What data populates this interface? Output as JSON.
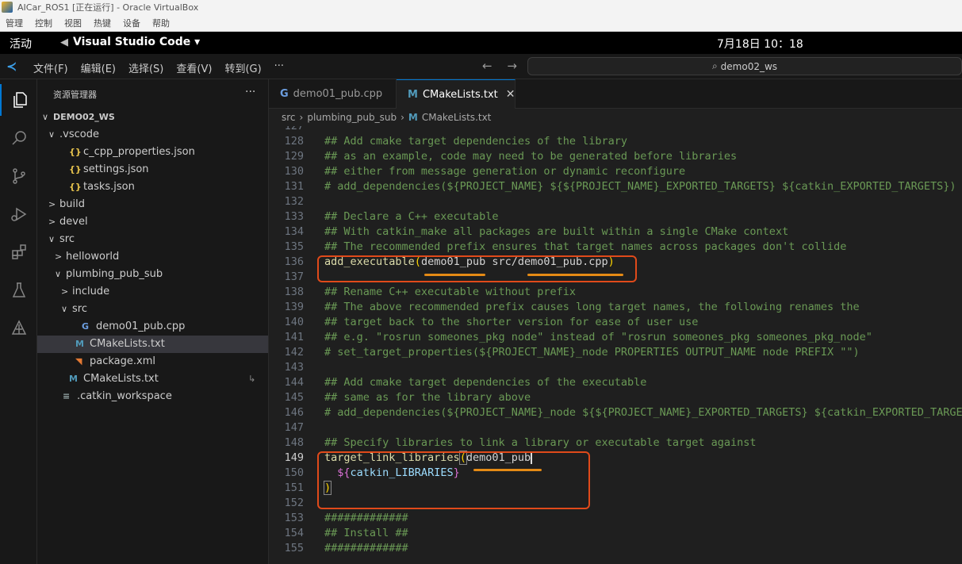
{
  "vbox": {
    "title": "AICar_ROS1 [正在运行] - Oracle VirtualBox",
    "menu": [
      "管理",
      "控制",
      "视图",
      "热键",
      "设备",
      "帮助"
    ]
  },
  "gnome": {
    "activities": "活动",
    "app_name": "Visual Studio Code ▾",
    "clock": "7月18日  10：18"
  },
  "vscode": {
    "menu": [
      "文件(F)",
      "编辑(E)",
      "选择(S)",
      "查看(V)",
      "转到(G)",
      "···"
    ],
    "nav_back": "←",
    "nav_forward": "→",
    "search_text": "demo02_ws",
    "explorer_title": "资源管理器",
    "explorer_more": "···",
    "tree": [
      {
        "label": "DEMO02_WS",
        "depth": 0,
        "chev": "∨",
        "icon": "",
        "bold": true
      },
      {
        "label": ".vscode",
        "depth": 1,
        "chev": "∨",
        "icon": ""
      },
      {
        "label": "c_cpp_properties.json",
        "depth": 2,
        "chev": "",
        "icon": "{}",
        "icon_class": "ic-json"
      },
      {
        "label": "settings.json",
        "depth": 2,
        "chev": "",
        "icon": "{}",
        "icon_class": "ic-json"
      },
      {
        "label": "tasks.json",
        "depth": 2,
        "chev": "",
        "icon": "{}",
        "icon_class": "ic-json"
      },
      {
        "label": "build",
        "depth": 1,
        "chev": ">",
        "icon": ""
      },
      {
        "label": "devel",
        "depth": 1,
        "chev": ">",
        "icon": ""
      },
      {
        "label": "src",
        "depth": 1,
        "chev": "∨",
        "icon": ""
      },
      {
        "label": "helloworld",
        "depth": 2,
        "chev": ">",
        "icon": ""
      },
      {
        "label": "plumbing_pub_sub",
        "depth": 2,
        "chev": "∨",
        "icon": ""
      },
      {
        "label": "include",
        "depth": 3,
        "chev": ">",
        "icon": ""
      },
      {
        "label": "src",
        "depth": 3,
        "chev": "∨",
        "icon": ""
      },
      {
        "label": "demo01_pub.cpp",
        "depth": 4,
        "chev": "",
        "icon": "G",
        "icon_class": "ic-cpp"
      },
      {
        "label": "CMakeLists.txt",
        "depth": 3,
        "chev": "",
        "icon": "M",
        "icon_class": "ic-m",
        "selected": true
      },
      {
        "label": "package.xml",
        "depth": 3,
        "chev": "",
        "icon": "◥",
        "icon_class": "ic-rss"
      },
      {
        "label": "CMakeLists.txt",
        "depth": 2,
        "chev": "",
        "icon": "M",
        "icon_class": "ic-m",
        "modifier": "↳"
      },
      {
        "label": ".catkin_workspace",
        "depth": 1,
        "chev": "",
        "icon": "≡",
        "icon_class": "ic-lines"
      }
    ],
    "tabs": [
      {
        "label": "demo01_pub.cpp",
        "icon": "G",
        "active": false
      },
      {
        "label": "CMakeLists.txt",
        "icon": "M",
        "active": true,
        "close": "✕"
      }
    ],
    "breadcrumb": [
      "src",
      "plumbing_pub_sub",
      "CMakeLists.txt"
    ],
    "breadcrumb_sep": "›",
    "current_line": "149",
    "lines": [
      {
        "n": "127",
        "t": [
          {
            "c": "c-plain",
            "s": ""
          }
        ]
      },
      {
        "n": "128",
        "t": [
          {
            "c": "c-comment",
            "s": "## Add cmake target dependencies of the library"
          }
        ]
      },
      {
        "n": "129",
        "t": [
          {
            "c": "c-comment",
            "s": "## as an example, code may need to be generated before libraries"
          }
        ]
      },
      {
        "n": "130",
        "t": [
          {
            "c": "c-comment",
            "s": "## either from message generation or dynamic reconfigure"
          }
        ]
      },
      {
        "n": "131",
        "t": [
          {
            "c": "c-comment",
            "s": "# add_dependencies(${PROJECT_NAME} ${${PROJECT_NAME}_EXPORTED_TARGETS} ${catkin_EXPORTED_TARGETS})"
          }
        ]
      },
      {
        "n": "132",
        "t": [
          {
            "c": "c-plain",
            "s": ""
          }
        ]
      },
      {
        "n": "133",
        "t": [
          {
            "c": "c-comment",
            "s": "## Declare a C++ executable"
          }
        ]
      },
      {
        "n": "134",
        "t": [
          {
            "c": "c-comment",
            "s": "## With catkin_make all packages are built within a single CMake context"
          }
        ]
      },
      {
        "n": "135",
        "t": [
          {
            "c": "c-comment",
            "s": "## The recommended prefix ensures that target names across packages don't collide"
          }
        ]
      },
      {
        "n": "136",
        "t": [
          {
            "c": "c-fn",
            "s": "add_executable"
          },
          {
            "c": "c-paren",
            "s": "("
          },
          {
            "c": "c-plain",
            "s": "demo01_pub src/demo01_pub.cpp"
          },
          {
            "c": "c-paren",
            "s": ")"
          }
        ]
      },
      {
        "n": "137",
        "t": [
          {
            "c": "c-plain",
            "s": ""
          }
        ]
      },
      {
        "n": "138",
        "t": [
          {
            "c": "c-comment",
            "s": "## Rename C++ executable without prefix"
          }
        ]
      },
      {
        "n": "139",
        "t": [
          {
            "c": "c-comment",
            "s": "## The above recommended prefix causes long target names, the following renames the"
          }
        ]
      },
      {
        "n": "140",
        "t": [
          {
            "c": "c-comment",
            "s": "## target back to the shorter version for ease of user use"
          }
        ]
      },
      {
        "n": "141",
        "t": [
          {
            "c": "c-comment",
            "s": "## e.g. \"rosrun someones_pkg node\" instead of \"rosrun someones_pkg someones_pkg_node\""
          }
        ]
      },
      {
        "n": "142",
        "t": [
          {
            "c": "c-comment",
            "s": "# set_target_properties(${PROJECT_NAME}_node PROPERTIES OUTPUT_NAME node PREFIX \"\")"
          }
        ]
      },
      {
        "n": "143",
        "t": [
          {
            "c": "c-plain",
            "s": ""
          }
        ]
      },
      {
        "n": "144",
        "t": [
          {
            "c": "c-comment",
            "s": "## Add cmake target dependencies of the executable"
          }
        ]
      },
      {
        "n": "145",
        "t": [
          {
            "c": "c-comment",
            "s": "## same as for the library above"
          }
        ]
      },
      {
        "n": "146",
        "t": [
          {
            "c": "c-comment",
            "s": "# add_dependencies(${PROJECT_NAME}_node ${${PROJECT_NAME}_EXPORTED_TARGETS} ${catkin_EXPORTED_TARGETS})"
          }
        ]
      },
      {
        "n": "147",
        "t": [
          {
            "c": "c-plain",
            "s": ""
          }
        ]
      },
      {
        "n": "148",
        "t": [
          {
            "c": "c-comment",
            "s": "## Specify libraries to link a library or executable target against"
          }
        ]
      },
      {
        "n": "149",
        "t": [
          {
            "c": "c-fn",
            "s": "target_link_libraries"
          },
          {
            "c": "c-paren bracket-hl",
            "s": "("
          },
          {
            "c": "c-plain",
            "s": "demo01_pub"
          },
          {
            "c": "cursor",
            "s": ""
          }
        ]
      },
      {
        "n": "150",
        "t": [
          {
            "c": "c-plain",
            "s": "  "
          },
          {
            "c": "c-brace",
            "s": "${"
          },
          {
            "c": "c-var",
            "s": "catkin_LIBRARIES"
          },
          {
            "c": "c-brace",
            "s": "}"
          }
        ]
      },
      {
        "n": "151",
        "t": [
          {
            "c": "c-paren bracket-hl",
            "s": ")"
          }
        ]
      },
      {
        "n": "152",
        "t": [
          {
            "c": "c-plain",
            "s": ""
          }
        ]
      },
      {
        "n": "153",
        "t": [
          {
            "c": "c-comment",
            "s": "#############"
          }
        ]
      },
      {
        "n": "154",
        "t": [
          {
            "c": "c-comment",
            "s": "## Install ##"
          }
        ]
      },
      {
        "n": "155",
        "t": [
          {
            "c": "c-comment",
            "s": "#############"
          }
        ]
      }
    ]
  },
  "colors": {
    "annotation_box": "#e04a1a",
    "annotation_underline": "#e48a15",
    "accent": "#0078d4"
  },
  "icons": [
    "explorer-icon",
    "search-icon",
    "source-control-icon",
    "run-debug-icon",
    "extensions-icon",
    "testing-icon",
    "ros-icon"
  ]
}
